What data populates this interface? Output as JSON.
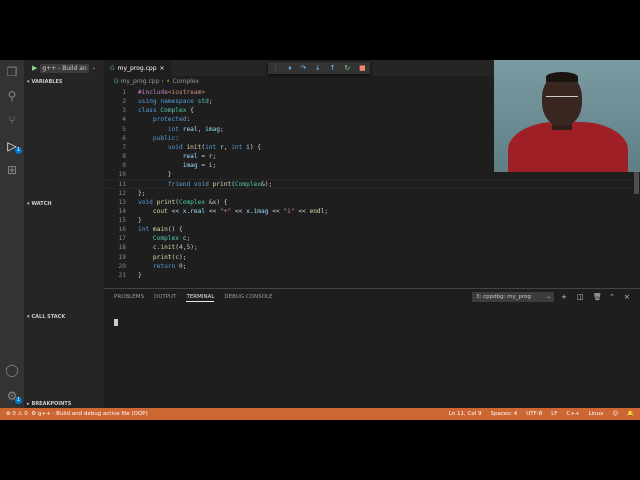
{
  "debug": {
    "config_label": "g++ - Build an"
  },
  "sidebar": {
    "sections": [
      "VARIABLES",
      "WATCH",
      "CALL STACK",
      "BREAKPOINTS"
    ]
  },
  "editor": {
    "tab_name": "my_prog.cpp",
    "breadcrumb_file": "my_prog.cpp",
    "breadcrumb_symbol": "Complex",
    "lines": [
      {
        "n": "1",
        "t": "#include<iostream>"
      },
      {
        "n": "2",
        "t": "using namespace std;"
      },
      {
        "n": "3",
        "t": "class Complex {"
      },
      {
        "n": "4",
        "t": "    protected:"
      },
      {
        "n": "5",
        "t": "        int real, imag;"
      },
      {
        "n": "6",
        "t": "    public:"
      },
      {
        "n": "7",
        "t": "        void init(int r, int i) {"
      },
      {
        "n": "8",
        "t": "            real = r;"
      },
      {
        "n": "9",
        "t": "            imag = i;"
      },
      {
        "n": "10",
        "t": "        }"
      },
      {
        "n": "11",
        "t": "        friend void print(Complex&);"
      },
      {
        "n": "12",
        "t": "};"
      },
      {
        "n": "13",
        "t": "void print(Complex &x) {"
      },
      {
        "n": "14",
        "t": "    cout << x.real << \"+\" << x.imag << \"i\" << endl;"
      },
      {
        "n": "15",
        "t": "}"
      },
      {
        "n": "16",
        "t": "int main() {"
      },
      {
        "n": "17",
        "t": "    Complex c;"
      },
      {
        "n": "18",
        "t": "    c.init(4,5);"
      },
      {
        "n": "19",
        "t": "    print(c);"
      },
      {
        "n": "20",
        "t": "    return 0;"
      },
      {
        "n": "21",
        "t": "}"
      }
    ]
  },
  "panel": {
    "tabs": [
      "PROBLEMS",
      "OUTPUT",
      "TERMINAL",
      "DEBUG CONSOLE"
    ],
    "active_tab": "TERMINAL",
    "terminal_select": "3: cppdbg: my_prog"
  },
  "statusbar": {
    "errors": "0",
    "warnings": "0",
    "task": "g++ - Build and debug active file (OOP)",
    "position": "Ln 11, Col 9",
    "spaces": "Spaces: 4",
    "encoding": "UTF-8",
    "eol": "LF",
    "language": "C++",
    "os": "Linux"
  },
  "colors": {
    "statusbar": "#cc6633",
    "activitybar": "#333333",
    "editor_bg": "#1e1e1e"
  }
}
